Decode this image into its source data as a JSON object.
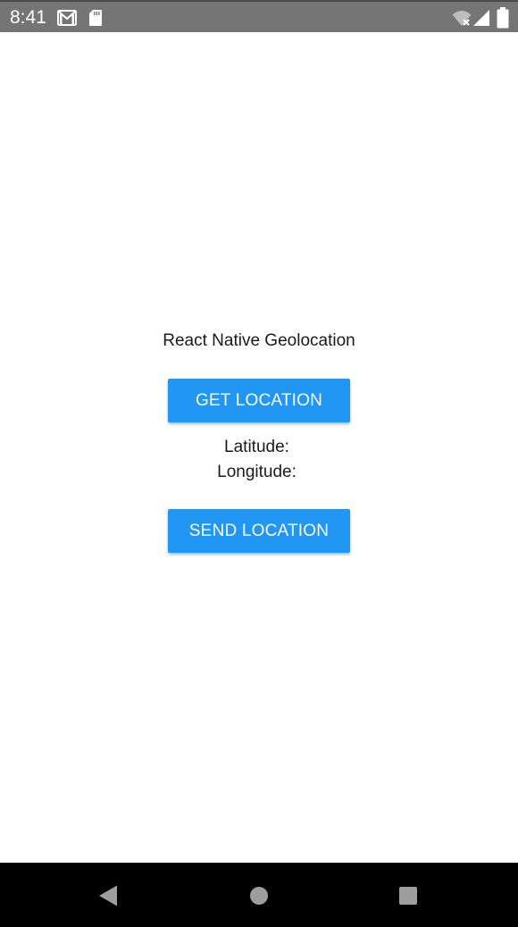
{
  "status_bar": {
    "time": "8:41",
    "icons": [
      "gmail-icon",
      "sd-card-icon",
      "wifi-no-internet-icon",
      "cell-signal-icon",
      "battery-icon"
    ],
    "background": "#757575"
  },
  "main": {
    "title": "React Native Geolocation",
    "get_location_label": "GET LOCATION",
    "latitude_label": "Latitude:",
    "latitude_value": "",
    "longitude_label": "Longitude:",
    "longitude_value": "",
    "send_location_label": "SEND LOCATION",
    "button_color": "#2196F3"
  },
  "nav_bar": {
    "icons": [
      "back-icon",
      "home-icon",
      "recents-icon"
    ],
    "background": "#000000"
  }
}
